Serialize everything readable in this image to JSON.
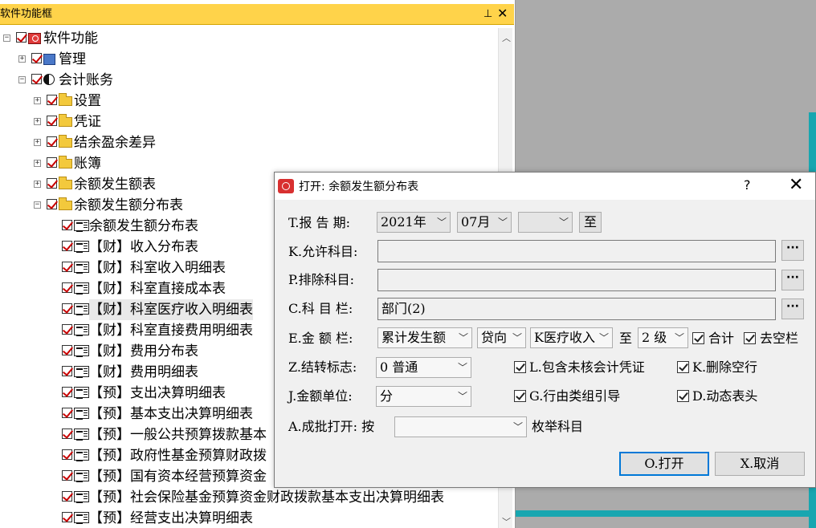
{
  "panel": {
    "title": "软件功能框",
    "pin_icon": "pin-icon",
    "close_icon": "close-icon"
  },
  "tree": [
    {
      "label": "软件功能",
      "toggle": "−",
      "icon": "root"
    },
    {
      "label": "管理",
      "toggle": "+",
      "icon": "mgr"
    },
    {
      "label": "会计账务",
      "toggle": "−",
      "icon": "yy"
    },
    {
      "label": "设置",
      "toggle": "+",
      "icon": "folder"
    },
    {
      "label": "凭证",
      "toggle": "+",
      "icon": "folder"
    },
    {
      "label": "结余盈余差异",
      "toggle": "+",
      "icon": "folder"
    },
    {
      "label": "账簿",
      "toggle": "+",
      "icon": "folder"
    },
    {
      "label": "余额发生额表",
      "toggle": "+",
      "icon": "folder"
    },
    {
      "label": "余额发生额分布表",
      "toggle": "−",
      "icon": "folder"
    },
    {
      "label": "余额发生额分布表",
      "icon": "report"
    },
    {
      "label": "【财】收入分布表",
      "icon": "report"
    },
    {
      "label": "【财】科室收入明细表",
      "icon": "report"
    },
    {
      "label": "【财】科室直接成本表",
      "icon": "report"
    },
    {
      "label": "【财】科室医疗收入明细表",
      "icon": "report",
      "selected": true
    },
    {
      "label": "【财】科室直接费用明细表",
      "icon": "report"
    },
    {
      "label": "【财】费用分布表",
      "icon": "report"
    },
    {
      "label": "【财】费用明细表",
      "icon": "report"
    },
    {
      "label": "【预】支出决算明细表",
      "icon": "report"
    },
    {
      "label": "【预】基本支出决算明细表",
      "icon": "report"
    },
    {
      "label": "【预】一般公共预算拨款基本",
      "icon": "report"
    },
    {
      "label": "【预】政府性基金预算财政拨",
      "icon": "report"
    },
    {
      "label": "【预】国有资本经营预算资金",
      "icon": "report"
    },
    {
      "label": "【预】社会保险基金预算资金财政拨款基本支出决算明细表",
      "icon": "report"
    },
    {
      "label": "【预】经营支出决算明细表",
      "icon": "report"
    }
  ],
  "dialog": {
    "title": "打开: 余额发生额分布表",
    "help": "?",
    "close": "✕",
    "period": {
      "label": "T.报 告 期:",
      "year": "2021年",
      "month": "07月",
      "end": "",
      "to_button": "至"
    },
    "allow_subject": {
      "label": "K.允许科目:",
      "value": "",
      "button": "···"
    },
    "exclude_subject": {
      "label": "P.排除科目:",
      "value": "",
      "button": "···"
    },
    "subject_col": {
      "label": "C.科 目 栏:",
      "value": "部门(2)",
      "button": "···"
    },
    "amount_col": {
      "label": "E.金 额 栏:",
      "type": "累计发生额",
      "direction": "贷向",
      "item": "K医疗收入",
      "to": "至",
      "level": "2 级",
      "total": "合计",
      "remove_empty_col": "去空栏"
    },
    "carry_flag": {
      "label": "Z.结转标志:",
      "value": "0 普通"
    },
    "unit": {
      "label": "J.金额单位:",
      "value": "分"
    },
    "batch": {
      "label": "A.成批打开: 按",
      "value": "",
      "suffix": "枚举科目"
    },
    "options": {
      "include_unaudited": "L.包含未核会计凭证",
      "delete_empty_rows": "K.删除空行",
      "group_guide": "G.行由类组引导",
      "dynamic_header": "D.动态表头"
    },
    "ok_button": "O.打开",
    "cancel_button": "X.取消"
  }
}
